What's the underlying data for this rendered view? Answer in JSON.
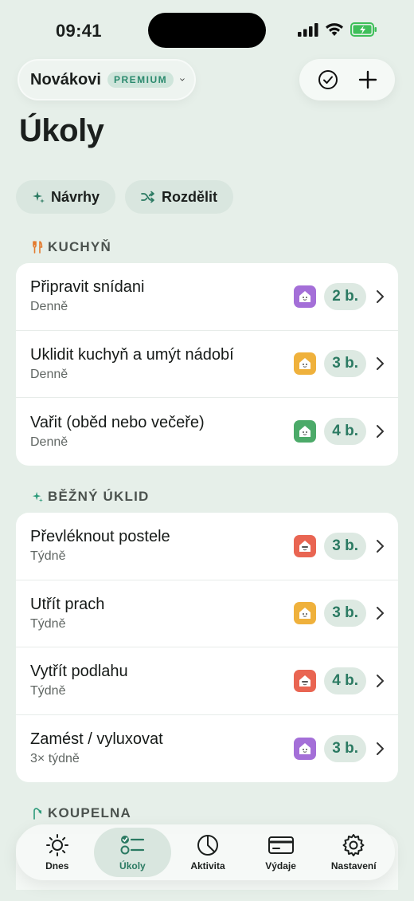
{
  "status": {
    "time": "09:41"
  },
  "header": {
    "household": "Novákovi",
    "badge": "PREMIUM",
    "title": "Úkoly"
  },
  "chips": [
    {
      "label": "Návrhy",
      "icon": "sparkle-icon"
    },
    {
      "label": "Rozdělit",
      "icon": "shuffle-icon"
    }
  ],
  "sections": [
    {
      "title": "KUCHYŇ",
      "icon": "fork-knife-icon",
      "tasks": [
        {
          "title": "Připravit snídani",
          "freq": "Denně",
          "points": "2 b.",
          "avatar_color": "#a46fd8"
        },
        {
          "title": "Uklidit kuchyň a umýt nádobí",
          "freq": "Denně",
          "points": "3 b.",
          "avatar_color": "#efb13c"
        },
        {
          "title": "Vařit (oběd nebo večeře)",
          "freq": "Denně",
          "points": "4 b.",
          "avatar_color": "#4caa69"
        }
      ]
    },
    {
      "title": "BĚŽNÝ ÚKLID",
      "icon": "sparkle-icon",
      "tasks": [
        {
          "title": "Převléknout postele",
          "freq": "Týdně",
          "points": "3 b.",
          "avatar_color": "#e96552"
        },
        {
          "title": "Utřít prach",
          "freq": "Týdně",
          "points": "3 b.",
          "avatar_color": "#efb13c"
        },
        {
          "title": "Vytřít podlahu",
          "freq": "Týdně",
          "points": "4 b.",
          "avatar_color": "#e96552"
        },
        {
          "title": "Zamést / vyluxovat",
          "freq": "3× týdně",
          "points": "3 b.",
          "avatar_color": "#a46fd8"
        }
      ]
    },
    {
      "title": "KOUPELNA",
      "icon": "shower-icon",
      "tasks": []
    }
  ],
  "tabs": [
    {
      "label": "Dnes",
      "icon": "sun-icon",
      "active": false
    },
    {
      "label": "Úkoly",
      "icon": "checklist-icon",
      "active": true
    },
    {
      "label": "Aktivita",
      "icon": "pie-chart-icon",
      "active": false
    },
    {
      "label": "Výdaje",
      "icon": "card-icon",
      "active": false
    },
    {
      "label": "Nastavení",
      "icon": "gear-icon",
      "active": false
    }
  ],
  "colors": {
    "accent": "#2b7a62",
    "background": "#e6efe9",
    "battery": "#3fbf5a"
  }
}
